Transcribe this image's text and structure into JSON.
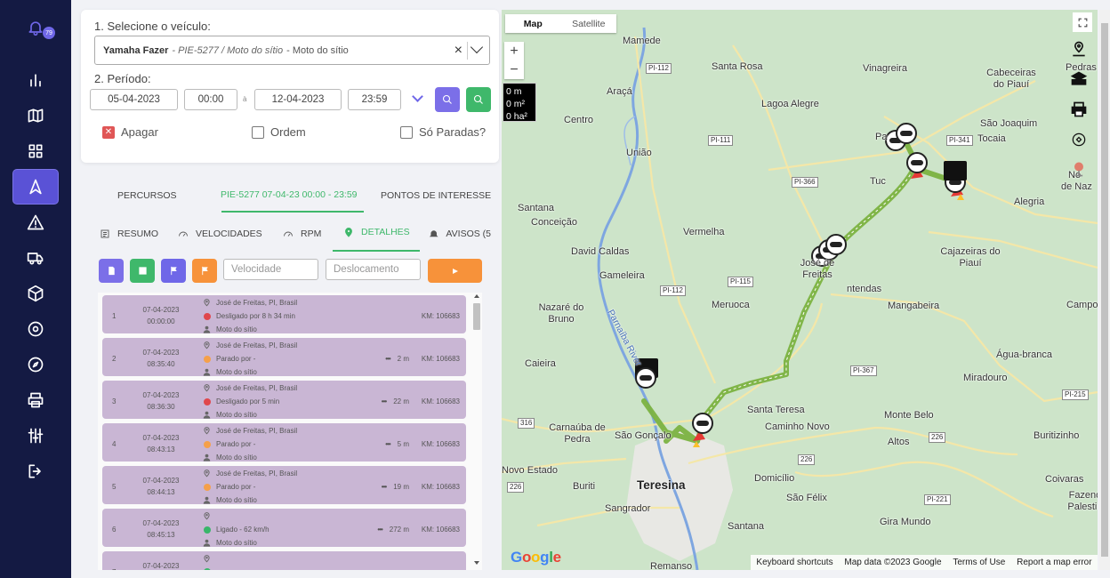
{
  "sidebar": {
    "notification_count": "79"
  },
  "form": {
    "step1_label": "1. Selecione o veículo:",
    "vehicle_name": "Yamaha Fazer",
    "vehicle_plate": "- PIE-5277 / Moto do sítio",
    "vehicle_group": "- Moto do sítio",
    "step2_label": "2. Período:",
    "date_start": "05-04-2023",
    "time_start": "00:00",
    "range_sep": "à",
    "date_end": "12-04-2023",
    "time_end": "23:59",
    "chk_apagar": "Apagar",
    "chk_ordem": "Ordem",
    "chk_paradas": "Só Paradas?"
  },
  "tabs": {
    "percursos": "PERCURSOS",
    "active": "PIE-5277 07-04-23 00:00 - 23:59",
    "pontos": "PONTOS DE INTERESSE"
  },
  "subtabs": {
    "resumo": "RESUMO",
    "velocidades": "VELOCIDADES",
    "rpm": "RPM",
    "detalhes": "DETALHES",
    "avisos": "AVISOS (5"
  },
  "filters": {
    "velocidade_placeholder": "Velocidade",
    "deslocamento_placeholder": "Deslocamento"
  },
  "colors": {
    "btn_doc": "#7b6fe8",
    "btn_grid": "#3fb86b",
    "btn_flag1": "#6f67e8",
    "btn_flag2": "#f7923a",
    "row_bg": "#c9b6d4",
    "dot_red": "#e0474c",
    "dot_orange": "#f5a04a",
    "dot_green": "#38b66a"
  },
  "rows": [
    {
      "n": "1",
      "date": "07-04-2023",
      "time": "00:00:00",
      "place": "José de Freitas, PI, Brasil",
      "status": "Desligado por 8 h 34 min",
      "status_color": "red",
      "driver": "Moto do sítio",
      "dist": "",
      "km": "KM: 106683"
    },
    {
      "n": "2",
      "date": "07-04-2023",
      "time": "08:35:40",
      "place": "José de Freitas, PI, Brasil",
      "status": "Parado por -",
      "status_color": "orange",
      "driver": "Moto do sítio",
      "dist": "2 m",
      "km": "KM: 106683"
    },
    {
      "n": "3",
      "date": "07-04-2023",
      "time": "08:36:30",
      "place": "José de Freitas, PI, Brasil",
      "status": "Desligado por 5 min",
      "status_color": "red",
      "driver": "Moto do sítio",
      "dist": "22 m",
      "km": "KM: 106683"
    },
    {
      "n": "4",
      "date": "07-04-2023",
      "time": "08:43:13",
      "place": "José de Freitas, PI, Brasil",
      "status": "Parado por -",
      "status_color": "orange",
      "driver": "Moto do sítio",
      "dist": "5 m",
      "km": "KM: 106683"
    },
    {
      "n": "5",
      "date": "07-04-2023",
      "time": "08:44:13",
      "place": "José de Freitas, PI, Brasil",
      "status": "Parado por -",
      "status_color": "orange",
      "driver": "Moto do sítio",
      "dist": "19 m",
      "km": "KM: 106683"
    },
    {
      "n": "6",
      "date": "07-04-2023",
      "time": "08:45:13",
      "place": "",
      "status": "Ligado - 62 km/h",
      "status_color": "green",
      "driver": "Moto do sítio",
      "dist": "272 m",
      "km": "KM: 106683"
    },
    {
      "n": "7",
      "date": "07-04-2023",
      "time": "",
      "place": "",
      "status": "",
      "status_color": "green",
      "driver": "",
      "dist": "",
      "km": ""
    }
  ],
  "map": {
    "btn_map": "Map",
    "btn_satellite": "Satellite",
    "zoom_in": "+",
    "zoom_out": "−",
    "measure_1": "0 m",
    "measure_2": "0 m²",
    "measure_3": "0 ha²",
    "footer_shortcuts": "Keyboard shortcuts",
    "footer_data": "Map data ©2023 Google",
    "footer_terms": "Terms of Use",
    "footer_report": "Report a map error",
    "logo": "Google",
    "places": [
      "Mamede",
      "Santa Rosa",
      "Vinagreira",
      "Cabeceiras do Piauí",
      "Pedras",
      "Araçá",
      "Lagoa Alegre",
      "São Joaquim",
      "Tocaia",
      "Centro",
      "União",
      "Alegria",
      "No",
      "de Naz",
      "Santana",
      "Conceição",
      "Vermelha",
      "Cajazeiras do Piauí",
      "David Caldas",
      "Gameleira",
      "José de Freitas",
      "ntendas",
      "Campo M",
      "Nazaré do Bruno",
      "Meruoca",
      "Mangabeira",
      "Caieira",
      "Parnaíba River",
      "Água-branca",
      "Miradouro",
      "Santa Teresa",
      "Monte Belo",
      "Carnaúba de Pedra",
      "São Gonçalo",
      "Caminho Novo",
      "Altos",
      "Buritizinho",
      "Novo Estado",
      "Teresina",
      "Domicílio",
      "Buriti",
      "Sangrador",
      "São Félix",
      "Coivaras",
      "Fazenda Palestina",
      "Gira Mundo",
      "Santana",
      "Remanso",
      "Pa",
      "Tuc"
    ],
    "roads": [
      "PI-112",
      "PI-111",
      "PI-366",
      "PI-341",
      "PI-112",
      "PI-115",
      "PI-367",
      "PI-215",
      "316",
      "226",
      "226",
      "226",
      "PI-221",
      "PI-113"
    ]
  }
}
